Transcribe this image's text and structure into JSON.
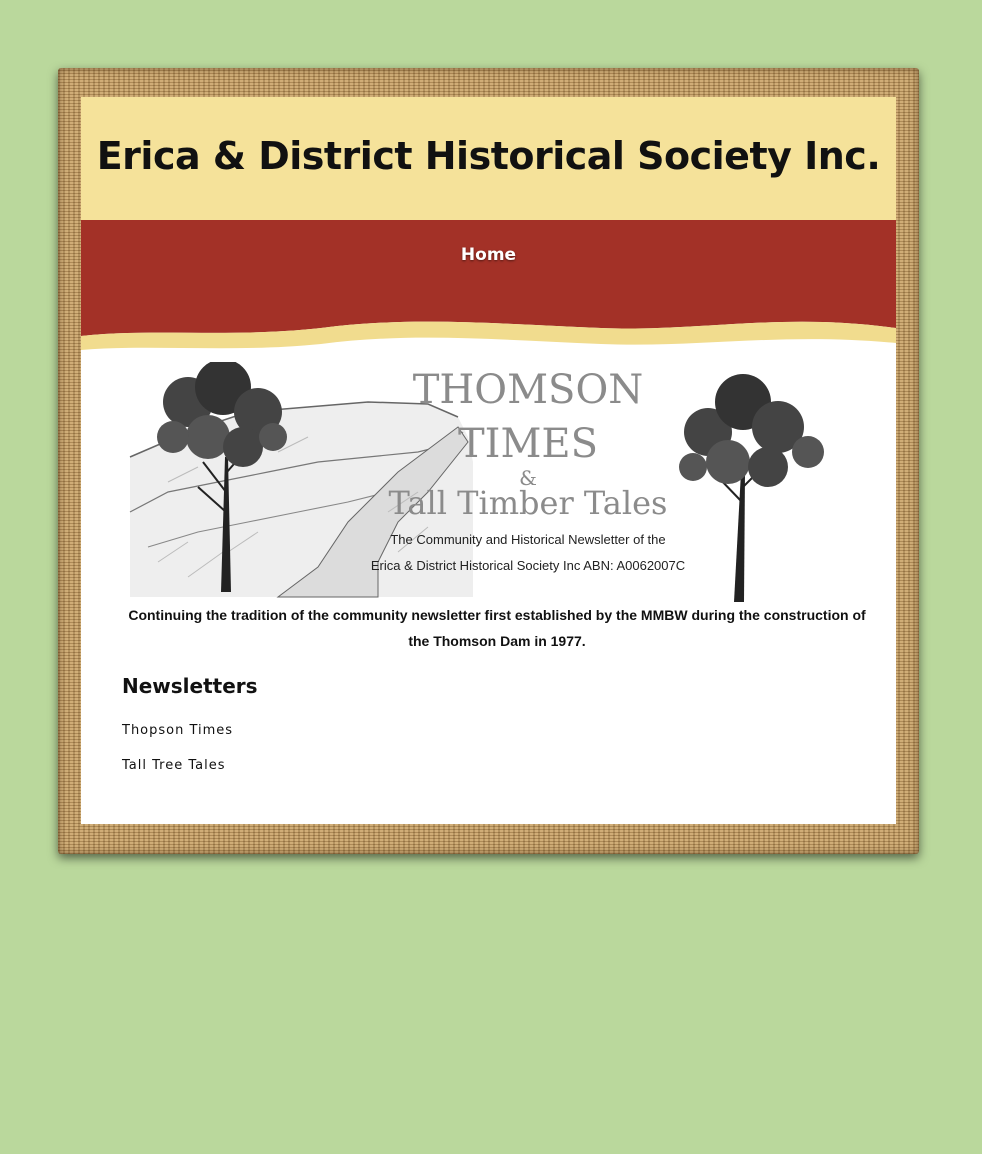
{
  "site": {
    "title": "Erica & District Historical Society Inc."
  },
  "nav": {
    "home_label": "Home"
  },
  "banner": {
    "masthead_line1": "THOMSON",
    "masthead_line2": "TIMES",
    "masthead_amp": "&",
    "masthead_line3": "Tall Timber Tales",
    "subtitle_line1": "The Community and Historical Newsletter of the",
    "subtitle_line2": "Erica & District Historical Society Inc  ABN: A0062007C",
    "tagline": "Continuing the tradition of the community newsletter first established by the MMBW during the construction of the Thomson Dam in 1977."
  },
  "newsletters": {
    "heading": "Newsletters",
    "links": [
      {
        "label": "Thopson Times"
      },
      {
        "label": "Tall Tree Tales"
      }
    ]
  },
  "colors": {
    "page_bg": "#bad89c",
    "header_bg": "#f5e29a",
    "nav_bg": "#a33127",
    "content_bg": "#ffffff"
  }
}
